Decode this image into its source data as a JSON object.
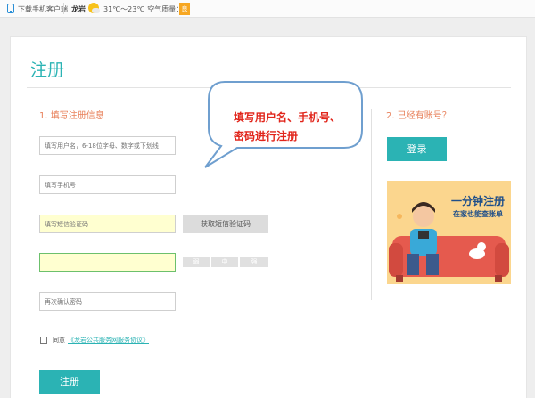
{
  "topbar": {
    "download": "下载手机客户端",
    "city": "龙岩",
    "temperature": "31℃～23℃",
    "air_quality_label": "| 空气质量：",
    "air_quality_badge": "良"
  },
  "page": {
    "title": "注册"
  },
  "form": {
    "step_title": "1. 填写注册信息",
    "username_placeholder": "填写用户名，6-18位字母、数字或下划线",
    "phone_placeholder": "填写手机号",
    "sms_placeholder": "填写短信验证码",
    "sms_button": "获取短信验证码",
    "password_value": "",
    "strength": [
      "弱",
      "中",
      "强"
    ],
    "confirm_placeholder": "再次确认密码",
    "agree_label": "同意",
    "terms_link": "《龙岩公共服务网服务协议》",
    "submit_label": "注册"
  },
  "login": {
    "step_title": "2. 已经有账号？",
    "button": "登录"
  },
  "ad": {
    "line1": "一分钟注册",
    "line2": "在家也能查账单"
  },
  "callout": {
    "line1": "填写用户名、手机号、",
    "line2": "密码进行注册"
  },
  "colors": {
    "accent": "#2bb3b4",
    "step": "#e8805a",
    "callout_text": "#e1251b",
    "field_highlight": "#ffffd0"
  }
}
